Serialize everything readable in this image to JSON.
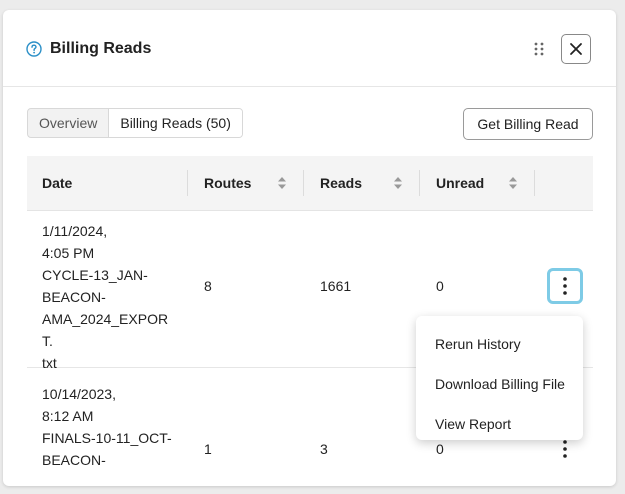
{
  "header": {
    "title": "Billing Reads",
    "icons": {
      "help": "help-circle-icon",
      "drag": "drag-handle-icon",
      "close": "close-icon"
    }
  },
  "tabs": [
    {
      "label": "Overview",
      "active": false
    },
    {
      "label": "Billing Reads (50)",
      "active": true
    }
  ],
  "actions": {
    "get_billing_read": "Get Billing Read"
  },
  "table": {
    "columns": [
      "Date",
      "Routes",
      "Reads",
      "Unread"
    ],
    "rows": [
      {
        "date": "1/11/2024,\n4:05 PM\nCYCLE-13_JAN-\nBEACON-\nAMA_2024_EXPORT.\ntxt",
        "routes": "8",
        "reads": "1661",
        "unread": "0"
      },
      {
        "date": "10/14/2023,\n8:12 AM\nFINALS-10-11_OCT-\nBEACON-",
        "routes": "1",
        "reads": "3",
        "unread": "0"
      }
    ]
  },
  "context_menu": {
    "items": [
      "Rerun History",
      "Download Billing File",
      "View Report"
    ]
  },
  "colors": {
    "accent": "#2a8fc7",
    "focus_ring": "#7ecbe6"
  }
}
